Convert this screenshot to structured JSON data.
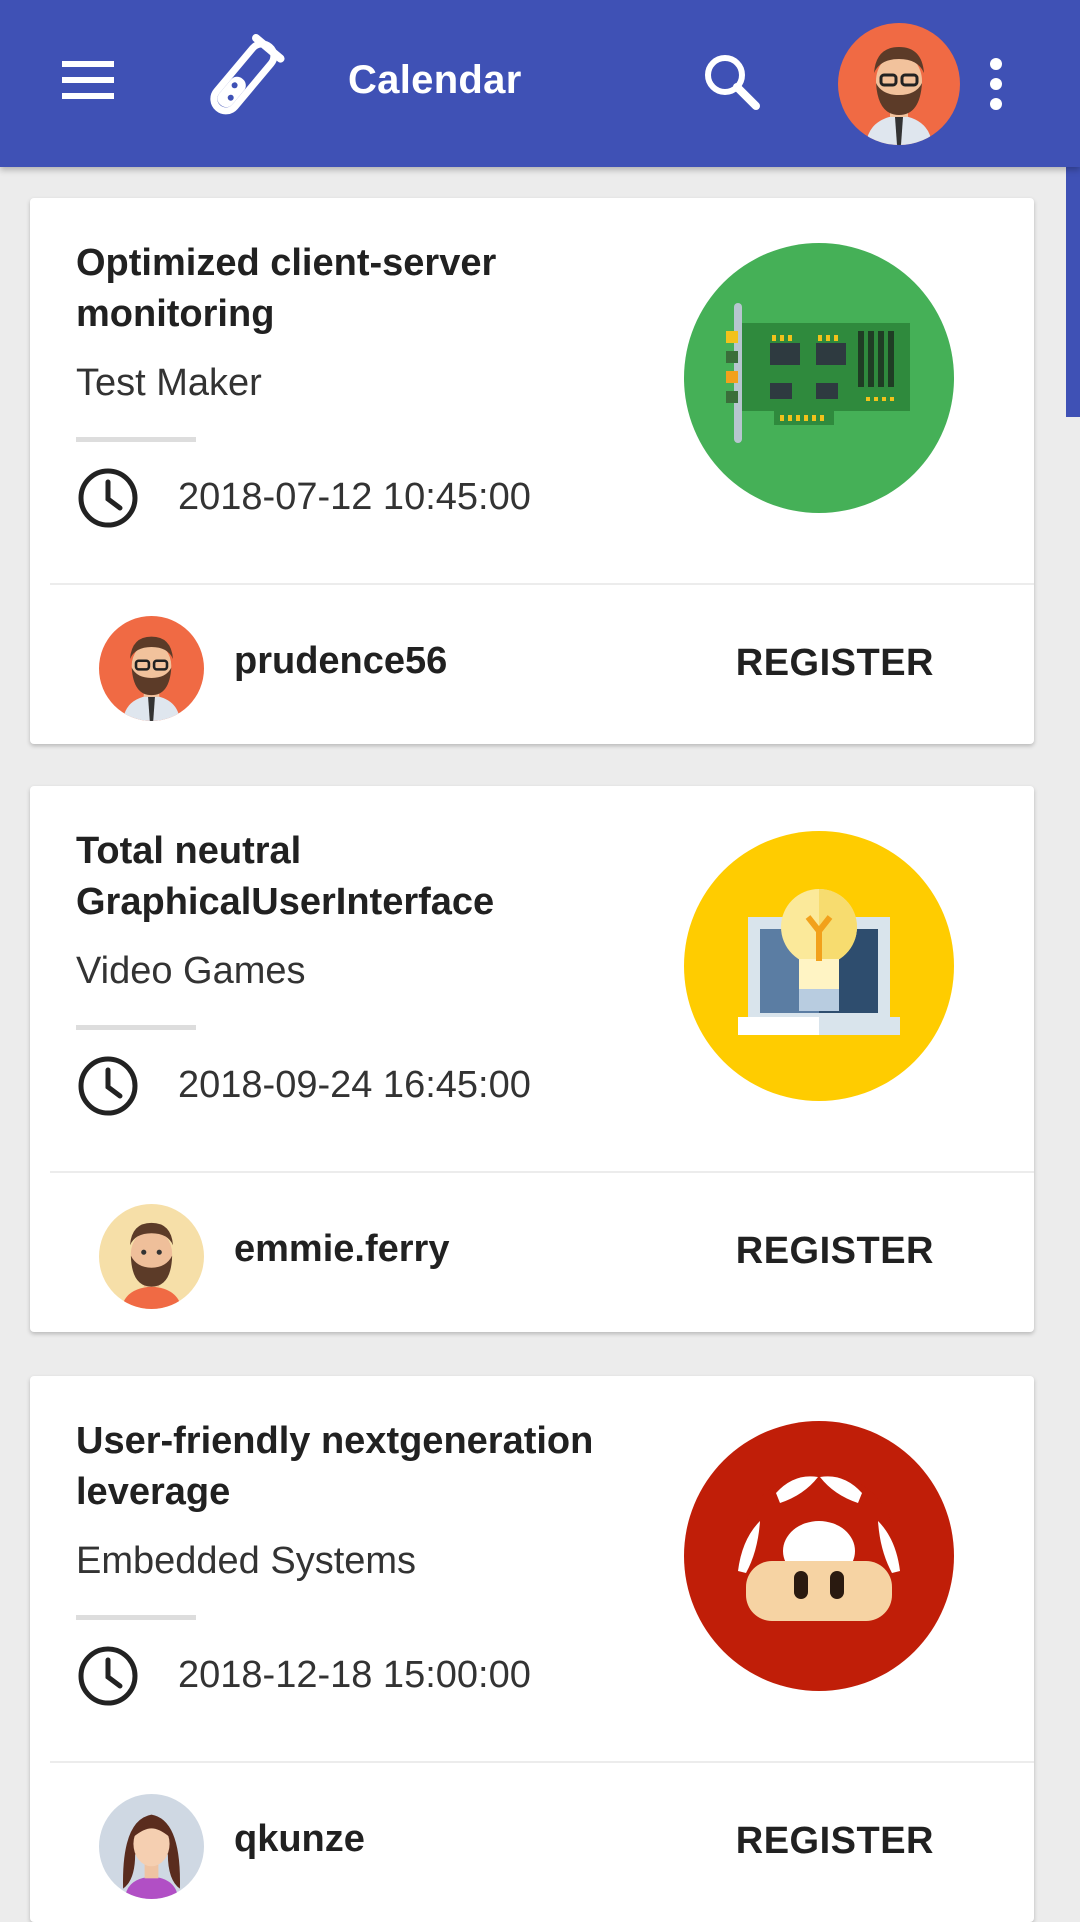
{
  "appbar": {
    "title": "Calendar",
    "color": "#3f51b5",
    "icons": [
      "menu-icon",
      "flask-icon",
      "search-icon",
      "more-vert-icon"
    ]
  },
  "cards": [
    {
      "title": "Optimized client-server monitoring",
      "category": "Test Maker",
      "datetime": "2018-07-12 10:45:00",
      "author": "prudence56",
      "register_label": "REGISTER",
      "illustration": "network-card",
      "illustration_color": "#45b057"
    },
    {
      "title": "Total neutral GraphicalUserInterface",
      "category": "Video Games",
      "datetime": "2018-09-24 16:45:00",
      "author": "emmie.ferry",
      "register_label": "REGISTER",
      "illustration": "laptop-lightbulb",
      "illustration_color": "#ffcc00"
    },
    {
      "title": "User-friendly nextgeneration leverage",
      "category": "Embedded Systems",
      "datetime": "2018-12-18 15:00:00",
      "author": "qkunze",
      "register_label": "REGISTER",
      "illustration": "mushroom",
      "illustration_color": "#c01e08"
    }
  ]
}
